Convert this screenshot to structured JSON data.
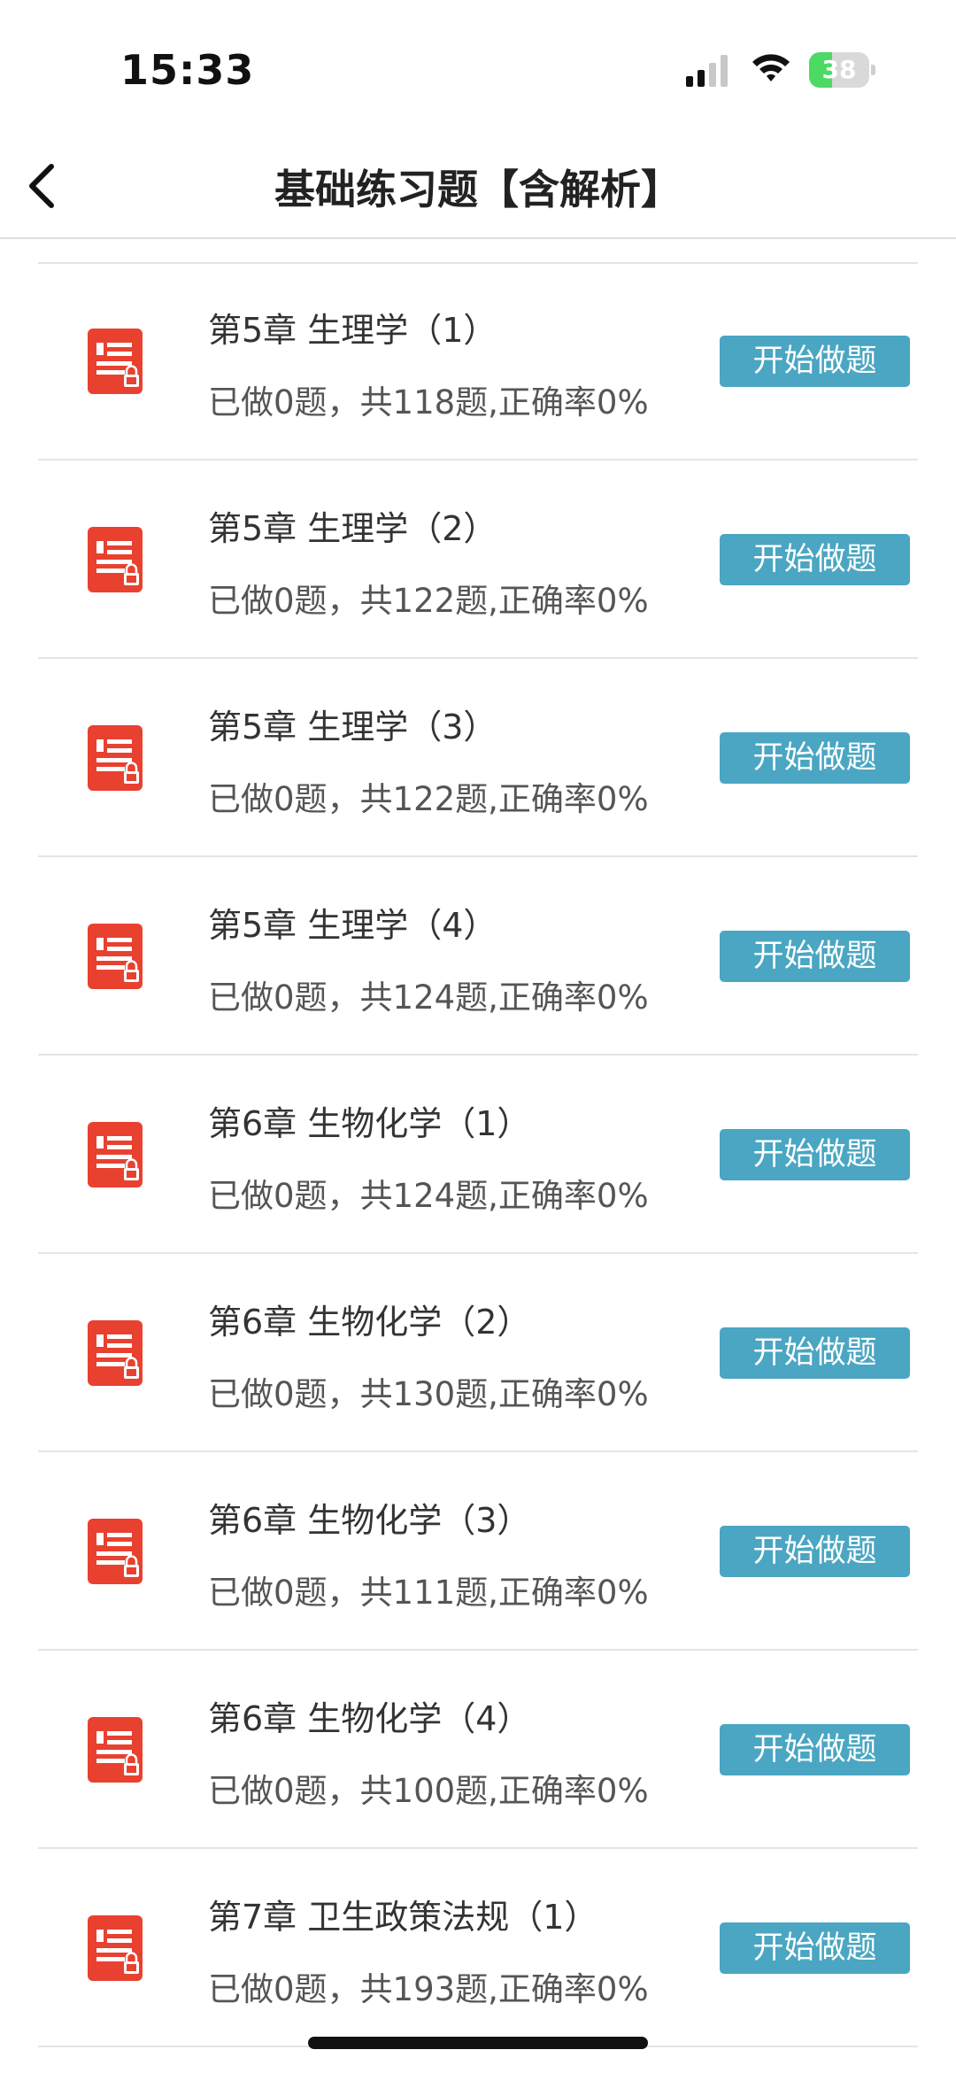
{
  "status_bar": {
    "time": "15:33",
    "battery_text": "38",
    "battery_level": 0.38,
    "icons": [
      "signal-icon",
      "wifi-icon",
      "battery-charging-icon"
    ]
  },
  "header": {
    "title": "基础练习题【含解析】",
    "back_icon": "chevron-left-icon"
  },
  "colors": {
    "accent": "#4aa6c2",
    "icon_red": "#e8412f",
    "battery_green": "#4cd964"
  },
  "rows": [
    {
      "title": "第5章 生理学（1）",
      "sub": "已做0题，共118题,正确率0%",
      "button": "开始做题"
    },
    {
      "title": "第5章 生理学（2）",
      "sub": "已做0题，共122题,正确率0%",
      "button": "开始做题"
    },
    {
      "title": "第5章 生理学（3）",
      "sub": "已做0题，共122题,正确率0%",
      "button": "开始做题"
    },
    {
      "title": "第5章 生理学（4）",
      "sub": "已做0题，共124题,正确率0%",
      "button": "开始做题"
    },
    {
      "title": "第6章 生物化学（1）",
      "sub": "已做0题，共124题,正确率0%",
      "button": "开始做题"
    },
    {
      "title": "第6章 生物化学（2）",
      "sub": "已做0题，共130题,正确率0%",
      "button": "开始做题"
    },
    {
      "title": "第6章 生物化学（3）",
      "sub": "已做0题，共111题,正确率0%",
      "button": "开始做题"
    },
    {
      "title": "第6章 生物化学（4）",
      "sub": "已做0题，共100题,正确率0%",
      "button": "开始做题"
    },
    {
      "title": "第7章 卫生政策法规（1）",
      "sub": "已做0题，共193题,正确率0%",
      "button": "开始做题"
    }
  ]
}
